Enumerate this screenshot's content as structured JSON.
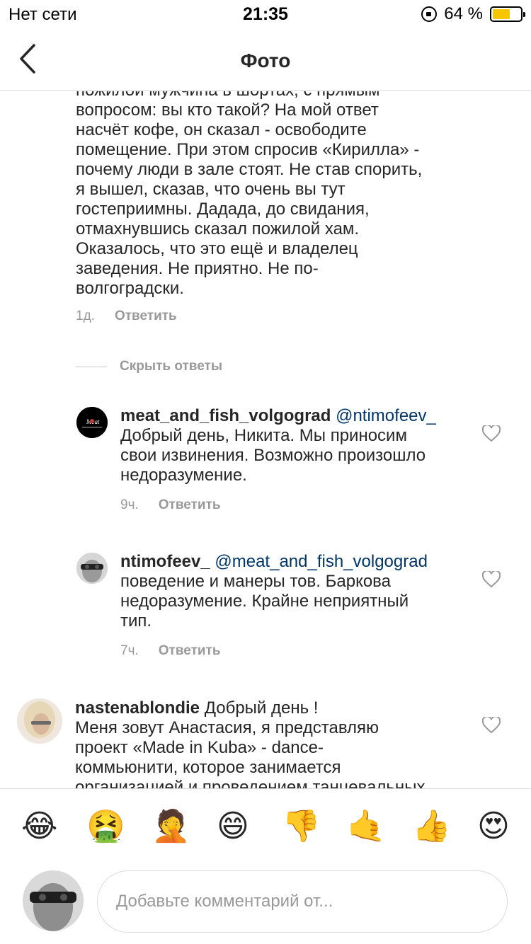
{
  "status_bar": {
    "carrier": "Нет сети",
    "time": "21:35",
    "battery_percent": "64 %",
    "battery_level": 0.64
  },
  "header": {
    "title": "Фото",
    "back_icon": "chevron-left-icon"
  },
  "top_comment": {
    "text_lines": [
      "пожилой мужчина в шортах, с прямым",
      "вопросом: вы кто такой? На мой ответ",
      "насчёт кофе, он сказал - освободите",
      "помещение. При этом спросив «Кирилла» -",
      "почему люди в зале стоят. Не став спорить,",
      "я вышел, сказав, что очень вы тут",
      "гостеприимны. Дадада, до свидания,",
      "отмахнувшись сказал пожилой хам.",
      "Оказалось, что это ещё и владелец",
      "заведения. Не приятно. Не по-",
      "волгоградски."
    ],
    "time": "1д.",
    "reply_label": "Ответить"
  },
  "hide_replies_label": "Скрыть ответы",
  "replies": [
    {
      "username": "meat_and_fish_volgograd",
      "mention": "@ntimofeev_",
      "lines": [
        "Добрый день, Никита. Мы приносим",
        "свои извинения. Возможно произошло",
        "недоразумение."
      ],
      "time": "9ч.",
      "reply_label": "Ответить"
    },
    {
      "username": "ntimofeev_",
      "mention": "@meat_and_fish_volgograd",
      "lines": [
        "поведение и манеры тов. Баркова",
        "недоразумение. Крайне неприятный",
        "тип."
      ],
      "time": "7ч.",
      "reply_label": "Ответить"
    }
  ],
  "third_comment": {
    "username": "nastenablondie",
    "first_text": "Добрый день !",
    "lines": [
      "Меня зовут Анастасия, я представляю",
      "проект «Made in Kuba» - dance-",
      "коммьюнити, которое занимается",
      "организацией и проведением танцевальных"
    ]
  },
  "emojis": [
    "😂",
    "🤮",
    "🤦",
    "😄",
    "👎",
    "🤙",
    "👍",
    "😍"
  ],
  "composer": {
    "placeholder": "Добавьте комментарий от..."
  },
  "colors": {
    "mention": "#003569",
    "meta_gray": "#999999",
    "battery": "#f7c600"
  }
}
